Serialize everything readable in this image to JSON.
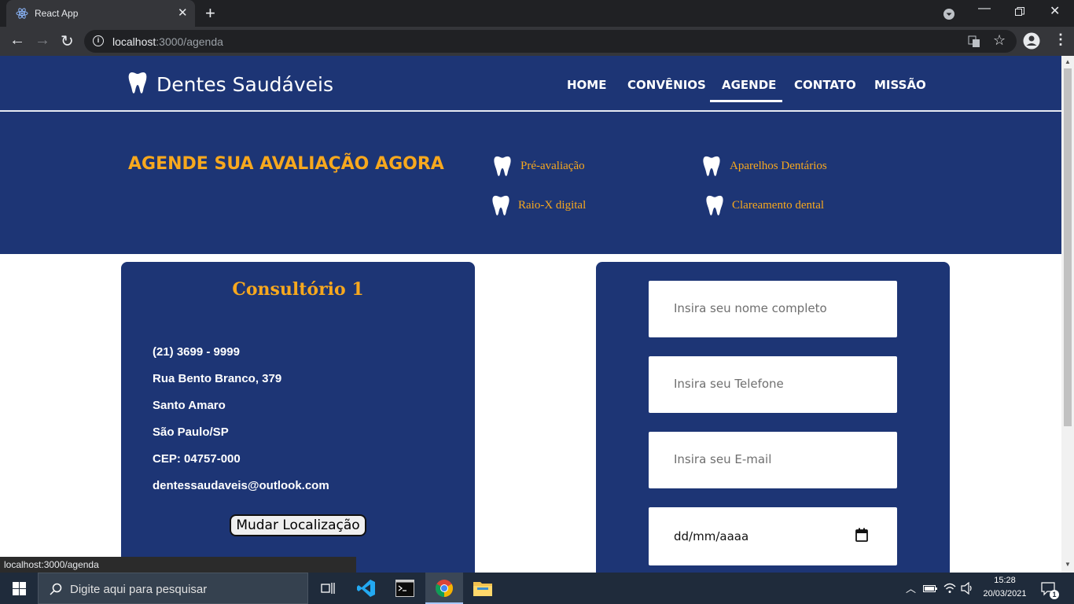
{
  "browser": {
    "tab_title": "React App",
    "url_host": "localhost",
    "url_path": ":3000/agenda",
    "status_url": "localhost:3000/agenda"
  },
  "navbar": {
    "brand": "Dentes Saudáveis",
    "links": [
      "HOME",
      "CONVÊNIOS",
      "AGENDE",
      "CONTATO",
      "MISSÃO"
    ],
    "active": "AGENDE"
  },
  "hero": {
    "title": "AGENDE SUA AVALIAÇÃO AGORA",
    "services": [
      "Pré-avaliação",
      "Aparelhos Dentários",
      "Raio-X digital",
      "Clareamento dental"
    ]
  },
  "clinic": {
    "title": "Consultório 1",
    "phone": "(21) 3699 - 9999",
    "street": "Rua Bento Branco, 379",
    "district": "Santo Amaro",
    "city": "São Paulo/SP",
    "cep": "CEP: 04757-000",
    "email": "dentessaudaveis@outlook.com",
    "button": "Mudar Localização"
  },
  "form": {
    "name_placeholder": "Insira seu nome completo",
    "phone_placeholder": "Insira seu Telefone",
    "email_placeholder": "Insira seu E-mail",
    "date_value": "dd/mm/aaaa"
  },
  "taskbar": {
    "search_placeholder": "Digite aqui para pesquisar",
    "time": "15:28",
    "date": "20/03/2021",
    "notifications": "1"
  },
  "colors": {
    "primary": "#1d3575",
    "accent": "#f7a81e"
  }
}
